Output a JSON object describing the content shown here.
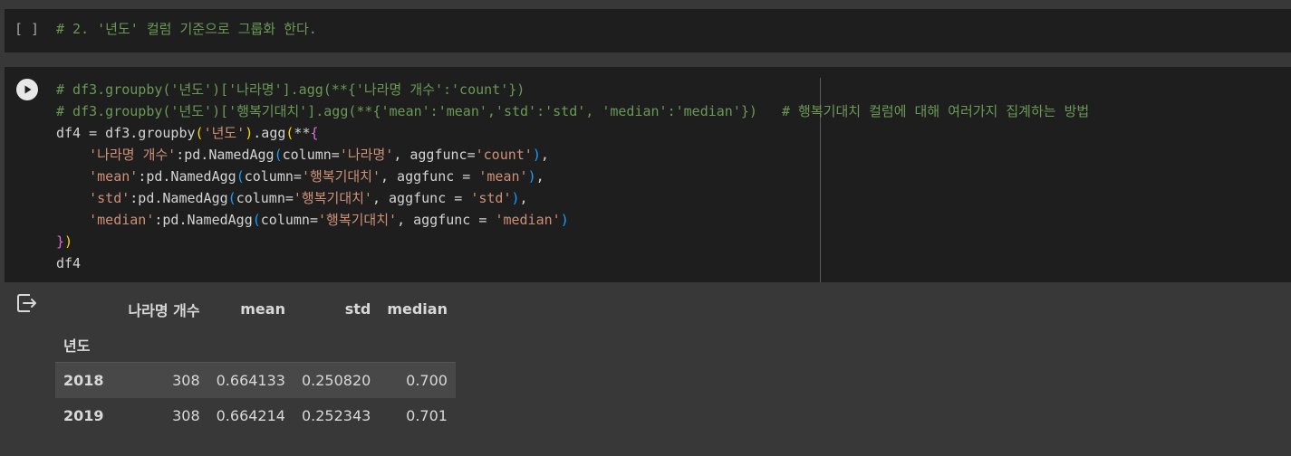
{
  "cell1": {
    "bracket": "[ ]",
    "comment": "# 2. '년도' 컬럼 기준으로 그룹화 한다."
  },
  "cell2": {
    "lines": {
      "l1": "# df3.groupby('년도')['나라명'].agg(**{'나라명 개수':'count'})",
      "l2": "# df3.groupby('년도')['행복기대치'].agg(**{'mean':'mean','std':'std', 'median':'median'})   # 행복기대치 컬럼에 대해 여러가지 집계하는 방법",
      "l3_a": "df4 = df3.groupby",
      "l3_b": "(",
      "l3_c": "'년도'",
      "l3_d": ")",
      "l3_e": ".agg",
      "l3_f": "(",
      "l3_g": "**",
      "l3_h": "{",
      "kw1": "'나라명 개수'",
      "kw2": "'mean'",
      "kw3": "'std'",
      "kw4": "'median'",
      "named_agg": ":pd.NamedAgg",
      "col_kw": "column=",
      "col1": "'나라명'",
      "col2": "'행복기대치'",
      "aggfunc1": ", aggfunc=",
      "aggfunc2": ", aggfunc = ",
      "fn1": "'count'",
      "fn2": "'mean'",
      "fn3": "'std'",
      "fn4": "'median'",
      "close_brace": "}",
      "close_paren": ")",
      "comma": ",",
      "last": "df4"
    }
  },
  "output": {
    "columns": [
      "나라명 개수",
      "mean",
      "std",
      "median"
    ],
    "index_name": "년도",
    "rows": [
      {
        "index": "2018",
        "values": [
          "308",
          "0.664133",
          "0.250820",
          "0.700"
        ]
      },
      {
        "index": "2019",
        "values": [
          "308",
          "0.664214",
          "0.252343",
          "0.701"
        ]
      }
    ]
  }
}
